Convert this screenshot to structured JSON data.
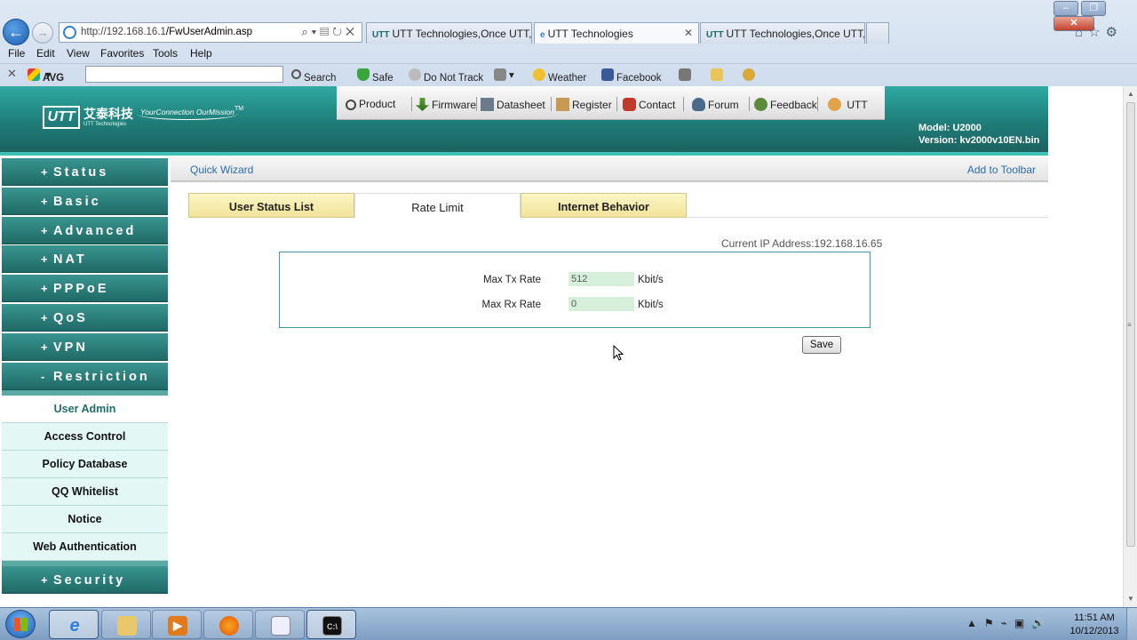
{
  "browser": {
    "address": {
      "url_host": "http://192.168.16.1",
      "url_path": "/FwUserAdmin.asp"
    },
    "tabs": [
      {
        "label": "UTT Technologies,Once UTT, ...",
        "icon": "utt-icon"
      },
      {
        "label": "UTT Technologies",
        "icon": "ie-page-icon",
        "active": true
      },
      {
        "label": "UTT Technologies,Once UTT, ..."
      }
    ],
    "menu": [
      "File",
      "Edit",
      "View",
      "Favorites",
      "Tools",
      "Help"
    ],
    "toolbar": {
      "avg_label": "AVG",
      "search": "Search",
      "safe": "Safe",
      "do_not_track": "Do Not Track",
      "weather": "Weather",
      "facebook": "Facebook"
    }
  },
  "banner": {
    "logo_text": "UTT",
    "logo_cn": "艾泰科技",
    "logo_en": "UTT Technologies",
    "slogan": "YourConnection OurMission",
    "tm": "TM",
    "model": "Model: U2000",
    "version": "Version: kv2000v10EN.bin"
  },
  "topnav": [
    "Product",
    "Firmware",
    "Datasheet",
    "Register",
    "Contact",
    "Forum",
    "Feedback",
    "UTT"
  ],
  "sidebar": {
    "sections": [
      {
        "prefix": "+",
        "label": "Status"
      },
      {
        "prefix": "+",
        "label": "Basic"
      },
      {
        "prefix": "+",
        "label": "Advanced"
      },
      {
        "prefix": "+",
        "label": "NAT"
      },
      {
        "prefix": "+",
        "label": "PPPoE"
      },
      {
        "prefix": "+",
        "label": "QoS"
      },
      {
        "prefix": "+",
        "label": "VPN"
      },
      {
        "prefix": "-",
        "label": "Restriction"
      }
    ],
    "restriction_items": [
      "User Admin",
      "Access Control",
      "Policy Database",
      "QQ Whitelist",
      "Notice",
      "Web Authentication"
    ],
    "security": {
      "prefix": "+",
      "label": "Security"
    }
  },
  "content": {
    "quick_wizard": "Quick Wizard",
    "add_to_toolbar": "Add to Toolbar",
    "tabs": [
      "User Status List",
      "Rate Limit",
      "Internet Behavior"
    ],
    "current_ip": "Current IP Address:192.168.16.65",
    "fields": [
      {
        "label": "Max Tx Rate",
        "value": "512",
        "unit": "Kbit/s"
      },
      {
        "label": "Max Rx Rate",
        "value": "0",
        "unit": "Kbit/s"
      }
    ],
    "save": "Save"
  },
  "taskbar": {
    "time": "11:51 AM",
    "date": "10/12/2013"
  },
  "colors": {
    "teal_dark": "#1b5e5d",
    "teal": "#2fa9a2",
    "tab_yellow": "#f1e39a",
    "input_green": "#d7f0dc",
    "link_blue": "#2b6ca8"
  }
}
